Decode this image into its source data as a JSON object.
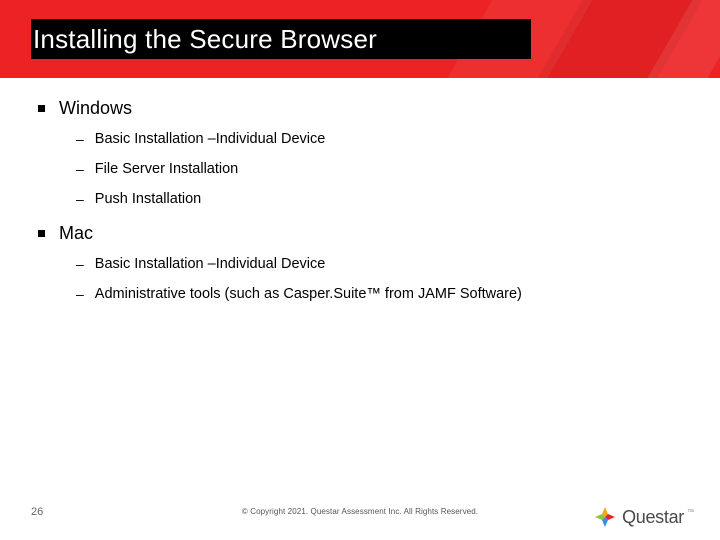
{
  "header": {
    "title": "Installing the Secure Browser"
  },
  "content": {
    "sections": [
      {
        "label": "Windows",
        "items": [
          "Basic Installation –Individual Device",
          "File Server Installation",
          "Push Installation"
        ]
      },
      {
        "label": "Mac",
        "items": [
          "Basic Installation –Individual Device",
          "Administrative tools (such as Casper.Suite™ from JAMF Software)"
        ]
      }
    ]
  },
  "footer": {
    "page_number": "26",
    "copyright": "© Copyright 2021. Questar Assessment Inc. All Rights Reserved.",
    "logo_text": "Questar"
  }
}
